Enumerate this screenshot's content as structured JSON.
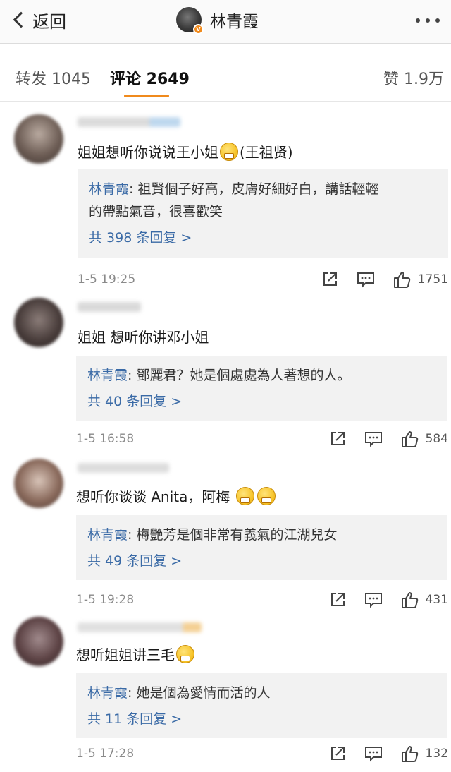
{
  "nav": {
    "back_label": "返回",
    "title": "林青霞"
  },
  "tabs": {
    "repost": "转发 1045",
    "comment": "评论 2649",
    "like": "赞 1.9万",
    "active_color": "#f08a1c"
  },
  "comments": [
    {
      "text": "姐姐想听你说说王小姐",
      "text_suffix": "(王祖贤)",
      "reply_author": "林青霞",
      "reply_text": ": 祖賢個子好高，皮膚好細好白，講話輕輕",
      "reply_text2": "的帶點氣音，很喜歡笑",
      "reply_more": "共 398 条回复 >",
      "time": "1-5 19:25",
      "likes": "1751"
    },
    {
      "text": "姐姐 想听你讲邓小姐",
      "reply_author": "林青霞",
      "reply_text": ": 鄧麗君？她是個處處為人著想的人。",
      "reply_more": "共 40 条回复 >",
      "time": "1-5 16:58",
      "likes": "584"
    },
    {
      "text": "想听你谈谈 Anita，阿梅",
      "reply_author": "林青霞",
      "reply_text": ": 梅艷芳是個非常有義氣的江湖兒女",
      "reply_more": "共 49 条回复 >",
      "time": "1-5 19:28",
      "likes": "431"
    },
    {
      "text": "想听姐姐讲三毛",
      "reply_author": "林青霞",
      "reply_text": ": 她是個為愛情而活的人",
      "reply_more": "共 11 条回复 >",
      "time": "1-5 17:28",
      "likes": "132"
    }
  ]
}
